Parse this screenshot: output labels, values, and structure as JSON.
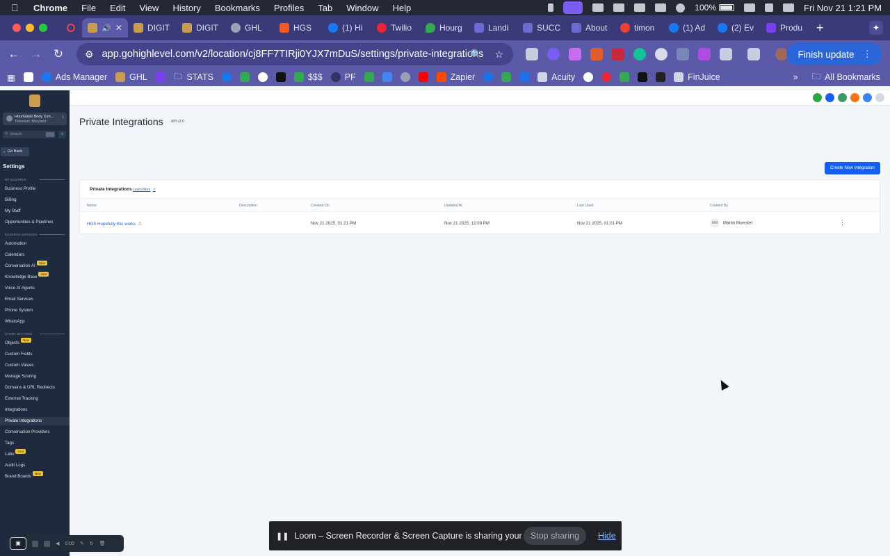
{
  "menubar": {
    "app": "Chrome",
    "items": [
      "File",
      "Edit",
      "View",
      "History",
      "Bookmarks",
      "Profiles",
      "Tab",
      "Window",
      "Help"
    ],
    "battery": "100%",
    "clock": "Fri Nov 21  1:21 PM"
  },
  "tabs": [
    {
      "label": "",
      "active": true,
      "color": "#c89d51"
    },
    {
      "label": "DIGIT",
      "color": "#c89d51"
    },
    {
      "label": "DIGIT",
      "color": "#c89d51"
    },
    {
      "label": "GHL",
      "color": "#9aa0b8"
    },
    {
      "label": "HGS",
      "color": "#f05a28"
    },
    {
      "label": "(1) Hi",
      "color": "#1877f2"
    },
    {
      "label": "Twilio",
      "color": "#e8253b"
    },
    {
      "label": "Hourg",
      "color": "#34a853"
    },
    {
      "label": "Landi",
      "color": "#6a6ad0"
    },
    {
      "label": "SUCC",
      "color": "#6a6ad0"
    },
    {
      "label": "About",
      "color": "#6a6ad0"
    },
    {
      "label": "timon",
      "color": "#ea4335"
    },
    {
      "label": "(1) Ad",
      "color": "#1877f2"
    },
    {
      "label": "(2) Ev",
      "color": "#1877f2"
    },
    {
      "label": "Produ",
      "color": "#7b3ff2"
    }
  ],
  "toolbar": {
    "url": "app.gohighlevel.com/v2/location/cj8FF7TIRji0YJX7mDuS/settings/private-integrations",
    "finish_update": "Finish update"
  },
  "bookmarks": {
    "items": [
      {
        "label": "",
        "color": "#ffffff"
      },
      {
        "label": "Ads Manager",
        "color": "#1877f2"
      },
      {
        "label": "GHL",
        "color": "#c89d51"
      },
      {
        "label": "",
        "color": "#7b3ff2"
      },
      {
        "label": "STATS",
        "color": "#eef"
      },
      {
        "label": "",
        "color": "#1877f2"
      },
      {
        "label": "",
        "color": "#34a853"
      },
      {
        "label": "",
        "color": "#ffffff"
      },
      {
        "label": "",
        "color": "#111111"
      },
      {
        "label": "$$$",
        "color": "#34a853"
      },
      {
        "label": "PF",
        "color": "#333366"
      },
      {
        "label": "",
        "color": "#34a853"
      },
      {
        "label": "",
        "color": "#4285f4"
      },
      {
        "label": "",
        "color": "#9aa0b8"
      },
      {
        "label": "",
        "color": "#ff0000"
      },
      {
        "label": "Zapier",
        "color": "#ff4a00"
      },
      {
        "label": "",
        "color": "#1a73e8"
      },
      {
        "label": "",
        "color": "#34a853"
      },
      {
        "label": "",
        "color": "#1a73e8"
      },
      {
        "label": "Acuity",
        "color": "#cfd6e6"
      }
    ],
    "extra_items": [
      {
        "label": "",
        "color": "#ffffff"
      },
      {
        "label": "",
        "color": "#e8253b"
      },
      {
        "label": "",
        "color": "#34a853"
      },
      {
        "label": "",
        "color": "#111111"
      },
      {
        "label": "",
        "color": "#222222"
      },
      {
        "label": "FinJuice",
        "color": "#cfd6e6"
      }
    ],
    "all_bookmarks": "All Bookmarks"
  },
  "sidebar": {
    "account_name": "HourGlass Body Con...",
    "account_location": "Timonium, Maryland",
    "search_placeholder": "Search",
    "go_back": "Go Back",
    "settings_title": "Settings",
    "sections": {
      "my_business": "MY BUSINESS",
      "business_services": "BUSINESS SERVICES",
      "other_settings": "OTHER SETTINGS"
    },
    "new_badge": "New",
    "items": [
      "Business Profile",
      "Billing",
      "My Staff",
      "Opportunities & Pipelines",
      "Automation",
      "Calendars",
      "Conversation AI",
      "Knowledge Base",
      "Voice AI Agents",
      "Email Services",
      "Phone System",
      "WhatsApp",
      "Objects",
      "Custom Fields",
      "Custom Values",
      "Manage Scoring",
      "Domains & URL Redirects",
      "External Tracking",
      "Integrations",
      "Private Integrations",
      "Conversation Providers",
      "Tags",
      "Labs",
      "Audit Logs",
      "Brand Boards"
    ]
  },
  "page": {
    "title": "Private Integrations",
    "api_badge": "API v2.0",
    "create_button": "Create New Integration",
    "card_title": "Private Integrations",
    "learn_more": "Learn More",
    "columns": [
      "Name",
      "Description",
      "Created On",
      "Updated At",
      "Last Used",
      "Created By"
    ],
    "row": {
      "name": "HGS Hopefully this works",
      "description": "",
      "created_on": "Nov 21 2025, 01:21 PM",
      "updated_at": "Nov 21 2025, 12:09 PM",
      "last_used": "Nov 21 2025, 01:01 PM",
      "creator_initials": "MM",
      "creator": "Martin Moeckel"
    }
  },
  "loom": {
    "timer": "0:00",
    "message": "Loom – Screen Recorder & Screen Capture is sharing your screen.",
    "stop": "Stop sharing",
    "hide": "Hide"
  }
}
